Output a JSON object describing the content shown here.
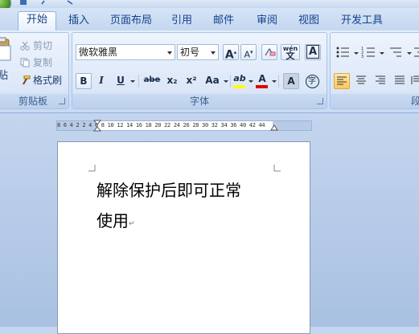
{
  "tabs": [
    {
      "label": "开始",
      "active": true
    },
    {
      "label": "插入"
    },
    {
      "label": "页面布局"
    },
    {
      "label": "引用"
    },
    {
      "label": "邮件"
    },
    {
      "label": "审阅"
    },
    {
      "label": "视图"
    },
    {
      "label": "开发工具"
    }
  ],
  "clipboard": {
    "paste_label": "贴",
    "cut_label": "剪切",
    "copy_label": "复制",
    "format_painter_label": "格式刷",
    "group_label": "剪贴板"
  },
  "font": {
    "font_name": "微软雅黑",
    "font_size": "初号",
    "group_label": "字体",
    "grow_label": "A",
    "shrink_label": "A",
    "phonetic_label": "wén",
    "bold_label": "B",
    "italic_label": "I",
    "underline_label": "U",
    "strike_label": "abe",
    "subscript_label": "x₂",
    "superscript_label": "x²",
    "case_label": "Aa",
    "highlight_label": "ab",
    "color_label": "A",
    "shade_label": "A",
    "border_label": "A",
    "enclose_label": "字",
    "highlight_color": "#ffff00",
    "font_color": "#e00000"
  },
  "paragraph": {
    "group_label": "段"
  },
  "ruler": {
    "numbers": "8  6  4  2     2  4  6  8 10 12 14 16 18 20 22 24 26 28 30 32 34 36   40 42 44"
  },
  "document": {
    "line1": "解除保护后即可正常",
    "line2": "使用",
    "para_mark": "↵"
  },
  "colors": {
    "accent": "#15428b",
    "ribbon_border": "#8db2e3",
    "active_button": "#ffc85c"
  }
}
